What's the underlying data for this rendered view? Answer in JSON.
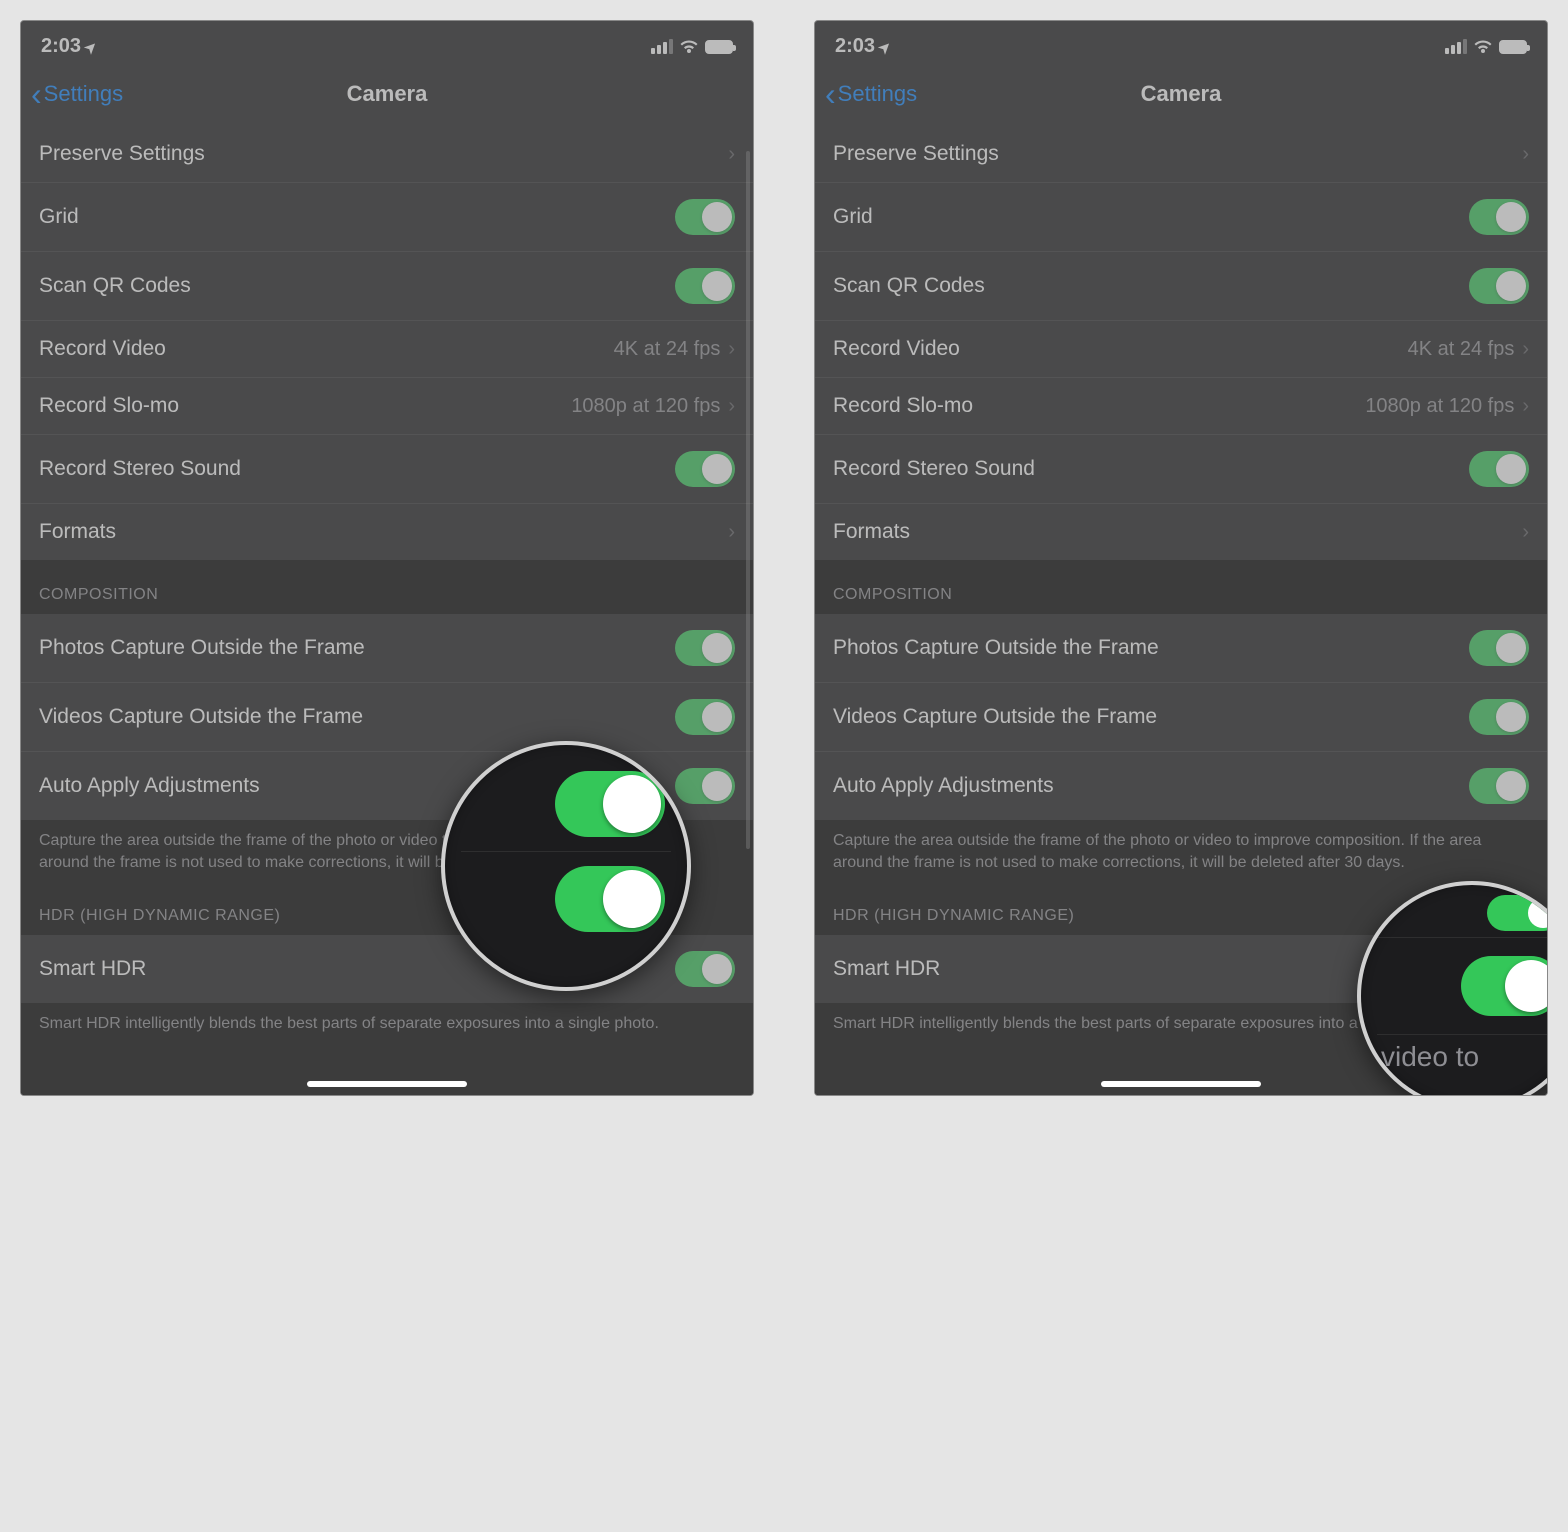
{
  "status": {
    "time": "2:03"
  },
  "nav": {
    "back_label": "Settings",
    "title": "Camera"
  },
  "rows": {
    "preserve": "Preserve Settings",
    "grid": "Grid",
    "qr": "Scan QR Codes",
    "video": "Record Video",
    "video_val": "4K at 24 fps",
    "slomo": "Record Slo-mo",
    "slomo_val": "1080p at 120 fps",
    "stereo": "Record Stereo Sound",
    "formats": "Formats"
  },
  "composition": {
    "header": "COMPOSITION",
    "photos": "Photos Capture Outside the Frame",
    "videos": "Videos Capture Outside the Frame",
    "auto": "Auto Apply Adjustments",
    "footer": "Capture the area outside the frame of the photo or video to improve composition. If the area around the frame is not used to make corrections, it will be deleted after 30 days."
  },
  "hdr": {
    "header": "HDR (HIGH DYNAMIC RANGE)",
    "smart": "Smart HDR",
    "footer": "Smart HDR intelligently blends the best parts of separate exposures into a single photo."
  },
  "mag2_text": "video to"
}
